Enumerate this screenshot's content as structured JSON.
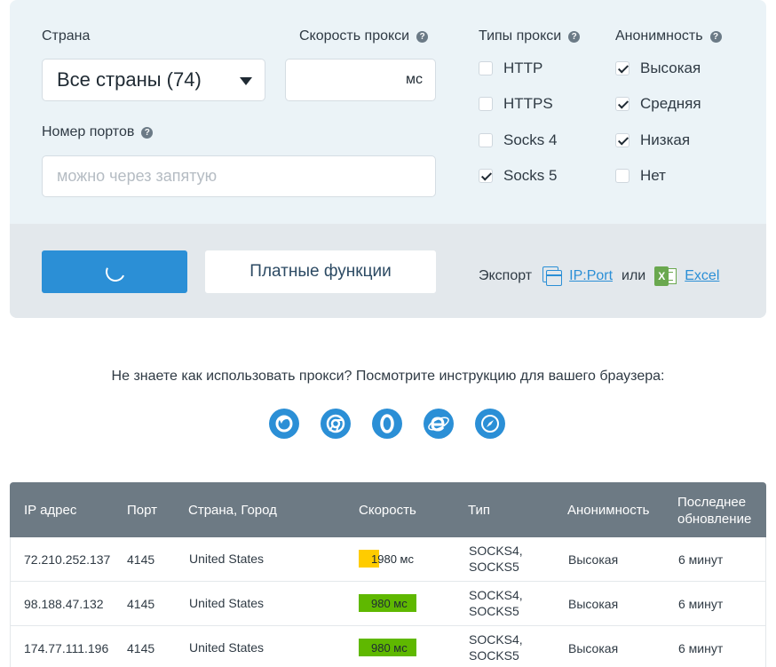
{
  "filters": {
    "country": {
      "label": "Страна",
      "value": "Все страны (74)"
    },
    "speed": {
      "label": "Скорость прокси",
      "value": "",
      "unit": "мс"
    },
    "ports": {
      "label": "Номер портов",
      "placeholder": "можно через запятую"
    },
    "proxy_types": {
      "label": "Типы прокси",
      "items": [
        {
          "label": "HTTP",
          "checked": false
        },
        {
          "label": "HTTPS",
          "checked": false
        },
        {
          "label": "Socks 4",
          "checked": false
        },
        {
          "label": "Socks 5",
          "checked": true
        }
      ]
    },
    "anonymity": {
      "label": "Анонимность",
      "items": [
        {
          "label": "Высокая",
          "checked": true
        },
        {
          "label": "Средняя",
          "checked": true
        },
        {
          "label": "Низкая",
          "checked": true
        },
        {
          "label": "Нет",
          "checked": false
        }
      ]
    },
    "help_glyph": "?"
  },
  "actions": {
    "paid_label": "Платные функции",
    "export_label": "Экспорт",
    "ipport_label": "IP:Port",
    "or_label": "или",
    "excel_label": "Excel"
  },
  "help": {
    "text": "Не знаете как использовать прокси? Посмотрите инструкцию для вашего браузера:",
    "browsers": [
      "firefox-icon",
      "chrome-icon",
      "opera-icon",
      "ie-icon",
      "safari-icon"
    ]
  },
  "table": {
    "headers": {
      "ip": "IP адрес",
      "port": "Порт",
      "location": "Страна, Город",
      "speed": "Скорость",
      "type": "Тип",
      "anon": "Анонимность",
      "updated_1": "Последнее",
      "updated_2": "обновление"
    },
    "rows": [
      {
        "ip": "72.210.252.137",
        "port": "4145",
        "location": "United States",
        "speed": "1980 мс",
        "speed_color": "#ffcc00",
        "speed_fill": 0.35,
        "type_1": "SOCKS4,",
        "type_2": "SOCKS5",
        "anon": "Высокая",
        "updated": "6 минут"
      },
      {
        "ip": "98.188.47.132",
        "port": "4145",
        "location": "United States",
        "speed": "980 мс",
        "speed_color": "#5fb800",
        "speed_fill": 0.98,
        "type_1": "SOCKS4,",
        "type_2": "SOCKS5",
        "anon": "Высокая",
        "updated": "6 минут"
      },
      {
        "ip": "174.77.111.196",
        "port": "4145",
        "location": "United States",
        "speed": "980 мс",
        "speed_color": "#5fb800",
        "speed_fill": 0.98,
        "type_1": "SOCKS4,",
        "type_2": "SOCKS5",
        "anon": "Высокая",
        "updated": "6 минут"
      }
    ]
  }
}
